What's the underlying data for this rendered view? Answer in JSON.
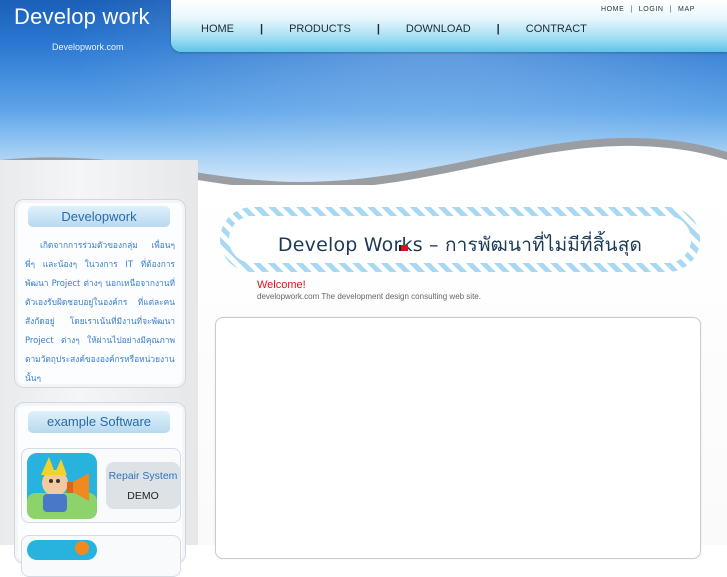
{
  "header": {
    "logo_title": "Develop work",
    "logo_sub": "Developwork.com",
    "top_menu": [
      "HOME",
      "LOGIN",
      "MAP"
    ],
    "main_menu": [
      "HOME",
      "PRODUCTS",
      "DOWNLOAD",
      "CONTRACT"
    ],
    "separator": "|"
  },
  "sidebar": {
    "about": {
      "title": "Developwork",
      "text": "เกิดจากการร่วมตัวของกลุ่ม เพื่อนๆ พี่ๆ และน้องๆ ในวงการ IT ที่ต้องการพัฒนา Project ต่างๆ นอกเหนือจากงานที่ตัวเองรับผิดชอบอยู่ในองค์กร ที่แต่ละคนสังกัดอยู่ โดยเราเน้นที่มีงานที่จะพัฒนา Project ต่างๆ ให้ผ่านไปอย่างมีคุณภาพ ตามวัตถุประสงค์ขององค์กรหรือหน่วยงานนั้นๆ"
    },
    "software": {
      "title": "example Software",
      "items": [
        {
          "name": "Repair System",
          "tag": "DEMO"
        }
      ]
    }
  },
  "main": {
    "banner_title": "Develop Works – การพัฒนาที่ไม่มีที่สิ้นสุด",
    "welcome": "Welcome!",
    "tagline": "developwork.com The development design consulting web site."
  },
  "colors": {
    "header_blue": "#2b78d2",
    "nav_cyan": "#5ec4e8",
    "sidebar_text": "#3b7fc6",
    "welcome_red": "#e8101a"
  }
}
